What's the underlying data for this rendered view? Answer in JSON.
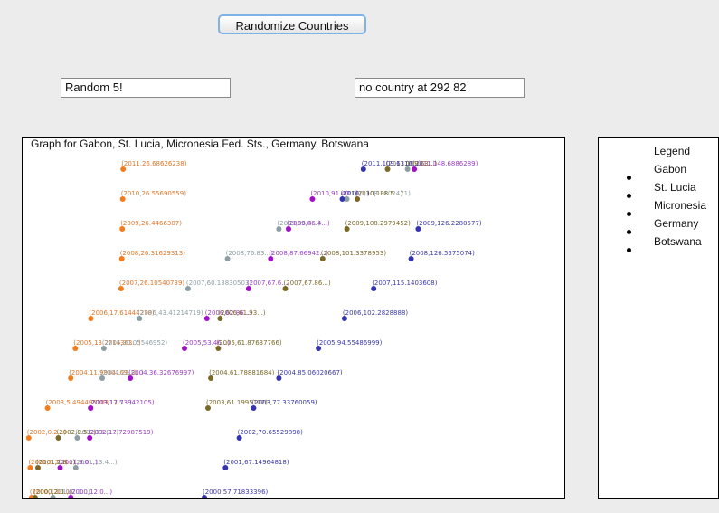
{
  "toolbar": {
    "randomize_label": "Randomize Countries"
  },
  "fields": {
    "random_text": "Random 5!",
    "hover_text": "no country at 292 82"
  },
  "legend": {
    "title": "Legend",
    "items": [
      "Gabon",
      "St. Lucia",
      "Micronesia",
      "Germany",
      "Botswana"
    ]
  },
  "chart_data": {
    "type": "scatter",
    "title": "Graph for Gabon, St. Lucia, Micronesia Fed. Sts., Germany, Botswana",
    "x_range": [
      0,
      150
    ],
    "year_range": [
      2000,
      2011
    ],
    "series": [
      {
        "name": "Gabon",
        "color": "#f47c1c",
        "label_color": "#e0772a",
        "points": [
          [
            2000,
            1.0
          ],
          [
            2001,
            0.6
          ],
          [
            2002,
            0.2
          ],
          [
            2003,
            5.49
          ],
          [
            2004,
            11.99
          ],
          [
            2005,
            13.27
          ],
          [
            2006,
            17.61
          ],
          [
            2007,
            26.11
          ],
          [
            2008,
            26.32
          ],
          [
            2009,
            26.45
          ],
          [
            2010,
            26.57
          ],
          [
            2011,
            26.69
          ]
        ],
        "labels": [
          "(2000,1.0...)",
          "(2001,0.7...)",
          "(2002,0.2...)",
          "(2003,5.494495203...)",
          "(2004,11.9934169...)",
          "(2005,13.2714363...)",
          "(2006,17.61444278)",
          "(2007,26.10540739)",
          "(2008,26.31629313)",
          "(2009,26.4466307)",
          "(2010,26.55690559)",
          "(2011,26.68626238)"
        ]
      },
      {
        "name": "St. Lucia",
        "color": "#8c9ea3",
        "label_color": "#8c9ea3",
        "points": [
          [
            2000,
            7.0
          ],
          [
            2001,
            13.4
          ],
          [
            2002,
            13.8
          ],
          [
            2003,
            17.5
          ],
          [
            2004,
            20.8
          ],
          [
            2005,
            21.3
          ],
          [
            2006,
            31.3
          ],
          [
            2007,
            44.9
          ],
          [
            2008,
            56.0
          ],
          [
            2009,
            70.4
          ],
          [
            2010,
            89.5
          ],
          [
            2011,
            106.5
          ]
        ],
        "labels": [
          "(2000,7.0...)",
          "(2001,13.4...)",
          "(2002,13.8...)",
          "(2003,17.5...)",
          "(2004,20.8...)",
          "(2005,30.05546952)",
          "(2006,43.41214719)",
          "(2007,60.13830503)",
          "(2008,76.83...)",
          "(2009,86.4...)",
          "(2010,108.3102471)",
          "(2011,...)"
        ]
      },
      {
        "name": "Micronesia",
        "color": "#a20fc8",
        "label_color": "#9b3fc2",
        "points": [
          [
            2000,
            12.0
          ],
          [
            2001,
            9.0
          ],
          [
            2002,
            17.3
          ],
          [
            2003,
            17.6
          ],
          [
            2004,
            28.7
          ],
          [
            2005,
            43.9
          ],
          [
            2006,
            50.2
          ],
          [
            2007,
            61.9
          ],
          [
            2008,
            68.1
          ],
          [
            2009,
            73.1
          ],
          [
            2010,
            79.8
          ],
          [
            2011,
            108.4
          ]
        ],
        "labels": [
          "(2000,12.0...)",
          "(2001,9.0...)",
          "(2002,17.72987519)",
          "(2003,17.73942105)",
          "(2004,36.32676997)",
          "(2005,53.46...)",
          "(2006,62.86...)",
          "(2007,67.6...)",
          "(2008,87.66942...)",
          "(2009,86.4...)",
          "(2010,91.40...)",
          "(2011,148.6886289)"
        ]
      },
      {
        "name": "Germany",
        "color": "#7a6828",
        "label_color": "#7a6828",
        "points": [
          [
            2000,
            2.0
          ],
          [
            2001,
            2.8
          ],
          [
            2002,
            8.5
          ],
          [
            2003,
            50.5
          ],
          [
            2004,
            51.3
          ],
          [
            2005,
            53.4
          ],
          [
            2006,
            53.9
          ],
          [
            2007,
            72.2
          ],
          [
            2008,
            82.7
          ],
          [
            2009,
            89.5
          ],
          [
            2010,
            92.4
          ],
          [
            2011,
            100.9
          ]
        ],
        "labels": [
          "(2000,2.0...)",
          "(2001,2.8...)",
          "(2002,8.5...)",
          "(2003,61.1995102)",
          "(2004,61.78881684)",
          "(2005,61.87637766)",
          "(2006,61.93...)",
          "(2007,67.86...)",
          "(2008,101.3378953)",
          "(2009,108.2979452)",
          "(2010,108.5...)",
          "(2011,109.63...)"
        ]
      },
      {
        "name": "Botswana",
        "color": "#3434b0",
        "label_color": "#3a3aa8",
        "points": [
          [
            2000,
            49.5
          ],
          [
            2001,
            55.4
          ],
          [
            2002,
            59.3
          ],
          [
            2003,
            63.3
          ],
          [
            2004,
            70.4
          ],
          [
            2005,
            81.5
          ],
          [
            2006,
            88.8
          ],
          [
            2007,
            97.0
          ],
          [
            2008,
            107.5
          ],
          [
            2009,
            109.5
          ],
          [
            2010,
            88.2
          ],
          [
            2011,
            94.1
          ]
        ],
        "labels": [
          "(2000,57.71833396)",
          "(2001,67.14964818)",
          "(2002,70.65529898)",
          "(2003,77.33760059)",
          "(2004,85.06020667)",
          "(2005,94.55486999)",
          "(2006,102.2828888)",
          "(2007,115.1403608)",
          "(2008,126.5575074)",
          "(2009,126.2280577)",
          "(2010,...)",
          "(2011,109.6316...)"
        ]
      }
    ]
  }
}
